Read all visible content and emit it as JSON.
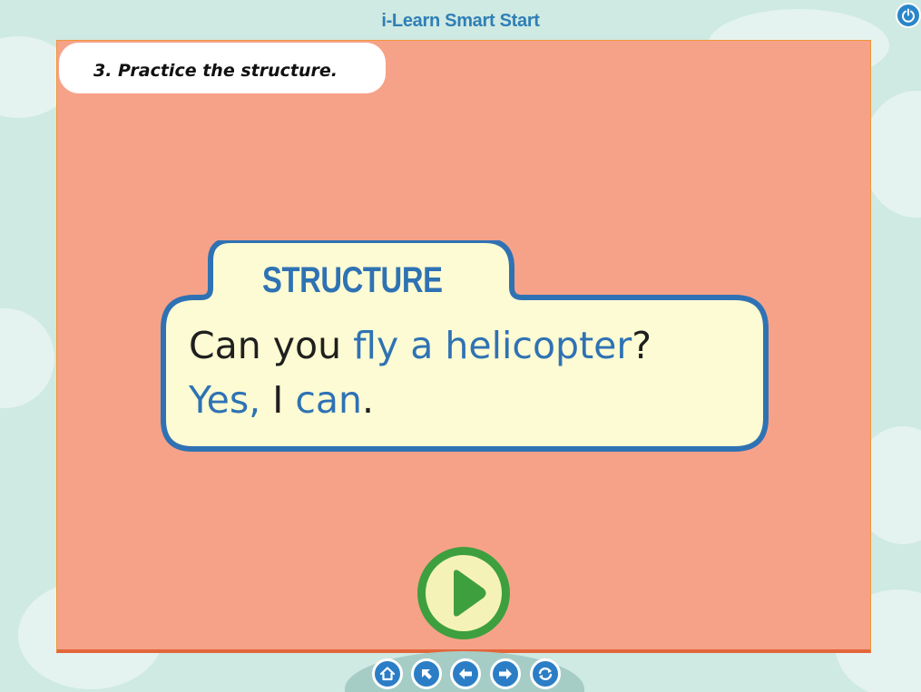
{
  "app": {
    "title": "i-Learn Smart Start"
  },
  "lesson": {
    "instruction": "3. Practice the structure.",
    "structure_label": "STRUCTURE",
    "line1": {
      "part1": "Can you ",
      "part2": "fly a helicopter",
      "part3": "?"
    },
    "line2": {
      "part1": "Yes,",
      "part2": " I ",
      "part3": "can",
      "part4": "."
    }
  },
  "icons": {
    "power": "power-icon",
    "play": "play-icon",
    "home": "home-icon",
    "back_to_start": "arrow-up-left-icon",
    "previous": "arrow-left-icon",
    "next": "arrow-right-icon",
    "replay": "refresh-icon"
  },
  "colors": {
    "background": "#cfe9e3",
    "stage": "#f6a289",
    "accent_blue": "#2f72b4",
    "box_fill": "#fdfbd3",
    "play_green": "#3e9f3e",
    "nav_blue": "#2b7ec6"
  }
}
